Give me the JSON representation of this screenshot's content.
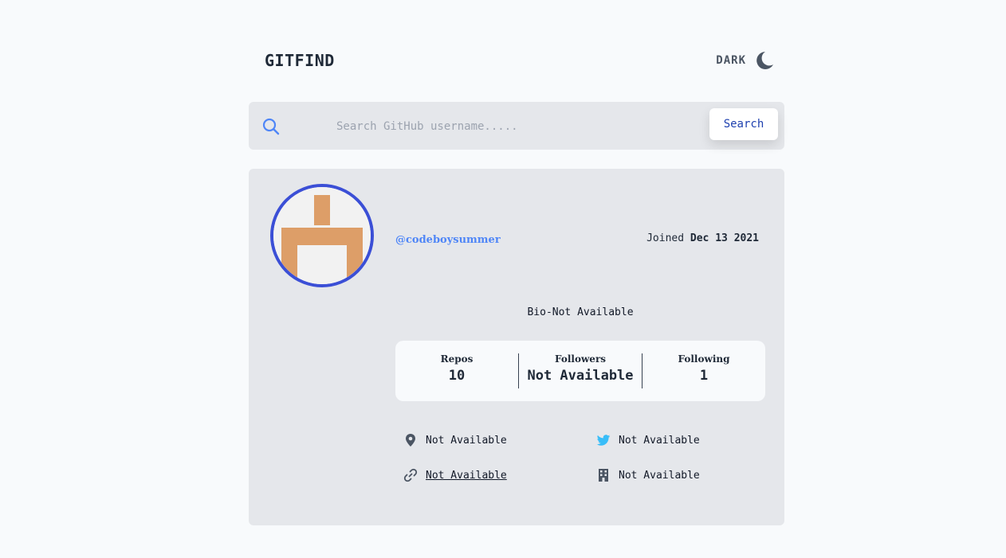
{
  "header": {
    "logo": "GITFIND",
    "theme_label": "DARK",
    "theme_icon": "moon-icon"
  },
  "search": {
    "placeholder": "Search GitHub username.....",
    "value": "",
    "button_label": "Search",
    "icon": "search-icon"
  },
  "profile": {
    "username": "@codeboysummer",
    "joined_label": "Joined",
    "joined_date": "Dec 13 2021",
    "bio": "Bio-Not Available",
    "avatar_colors": {
      "ring": "#3b4fd6",
      "shape": "#dd9e68",
      "background": "#f2f2f2"
    }
  },
  "stats": [
    {
      "label": "Repos",
      "value": "10"
    },
    {
      "label": "Followers",
      "value": "Not Available"
    },
    {
      "label": "Following",
      "value": "1"
    }
  ],
  "links": {
    "location": {
      "icon": "location-pin-icon",
      "text": "Not Available"
    },
    "twitter": {
      "icon": "twitter-icon",
      "text": "Not Available"
    },
    "website": {
      "icon": "link-icon",
      "text": "Not Available"
    },
    "company": {
      "icon": "building-icon",
      "text": "Not Available"
    }
  },
  "colors": {
    "page_bg": "#f8fafc",
    "panel_bg": "#e5e7eb",
    "accent": "#4f86f7",
    "button_text": "#1e40af"
  }
}
